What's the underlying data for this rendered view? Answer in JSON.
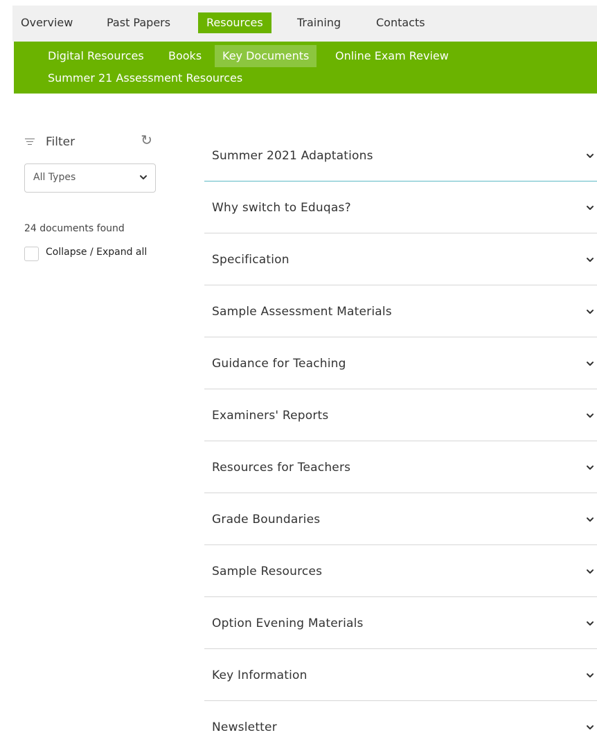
{
  "topnav": {
    "items": [
      {
        "label": "Overview",
        "active": false
      },
      {
        "label": "Past Papers",
        "active": false
      },
      {
        "label": "Resources",
        "active": true
      },
      {
        "label": "Training",
        "active": false
      },
      {
        "label": "Contacts",
        "active": false
      }
    ]
  },
  "subnav": {
    "items": [
      {
        "label": "Digital Resources",
        "active": false
      },
      {
        "label": "Books",
        "active": false
      },
      {
        "label": "Key Documents",
        "active": true
      },
      {
        "label": "Online Exam Review",
        "active": false
      },
      {
        "label": "Summer 21 Assessment Resources",
        "active": false
      }
    ]
  },
  "sidebar": {
    "filter_label": "Filter",
    "filter_icon": "filter-icon",
    "refresh_icon": "refresh-icon",
    "type_select": {
      "value": "All Types",
      "icon": "chevron-down-icon"
    },
    "doc_count": "24 documents found",
    "collapse_label": "Collapse / Expand all",
    "collapse_checked": false
  },
  "accordion": {
    "items": [
      {
        "title": "Summer 2021 Adaptations"
      },
      {
        "title": "Why switch to Eduqas?"
      },
      {
        "title": "Specification"
      },
      {
        "title": "Sample Assessment Materials"
      },
      {
        "title": "Guidance for Teaching"
      },
      {
        "title": "Examiners' Reports"
      },
      {
        "title": "Resources for Teachers"
      },
      {
        "title": "Grade Boundaries"
      },
      {
        "title": "Sample Resources"
      },
      {
        "title": "Option Evening Materials"
      },
      {
        "title": "Key Information"
      },
      {
        "title": "Newsletter"
      }
    ]
  },
  "colors": {
    "accent_green": "#6bb300",
    "active_sub_green": "#8cc63f",
    "divider_teal": "#5bb8c4",
    "nav_bg": "#f0f0f0"
  }
}
